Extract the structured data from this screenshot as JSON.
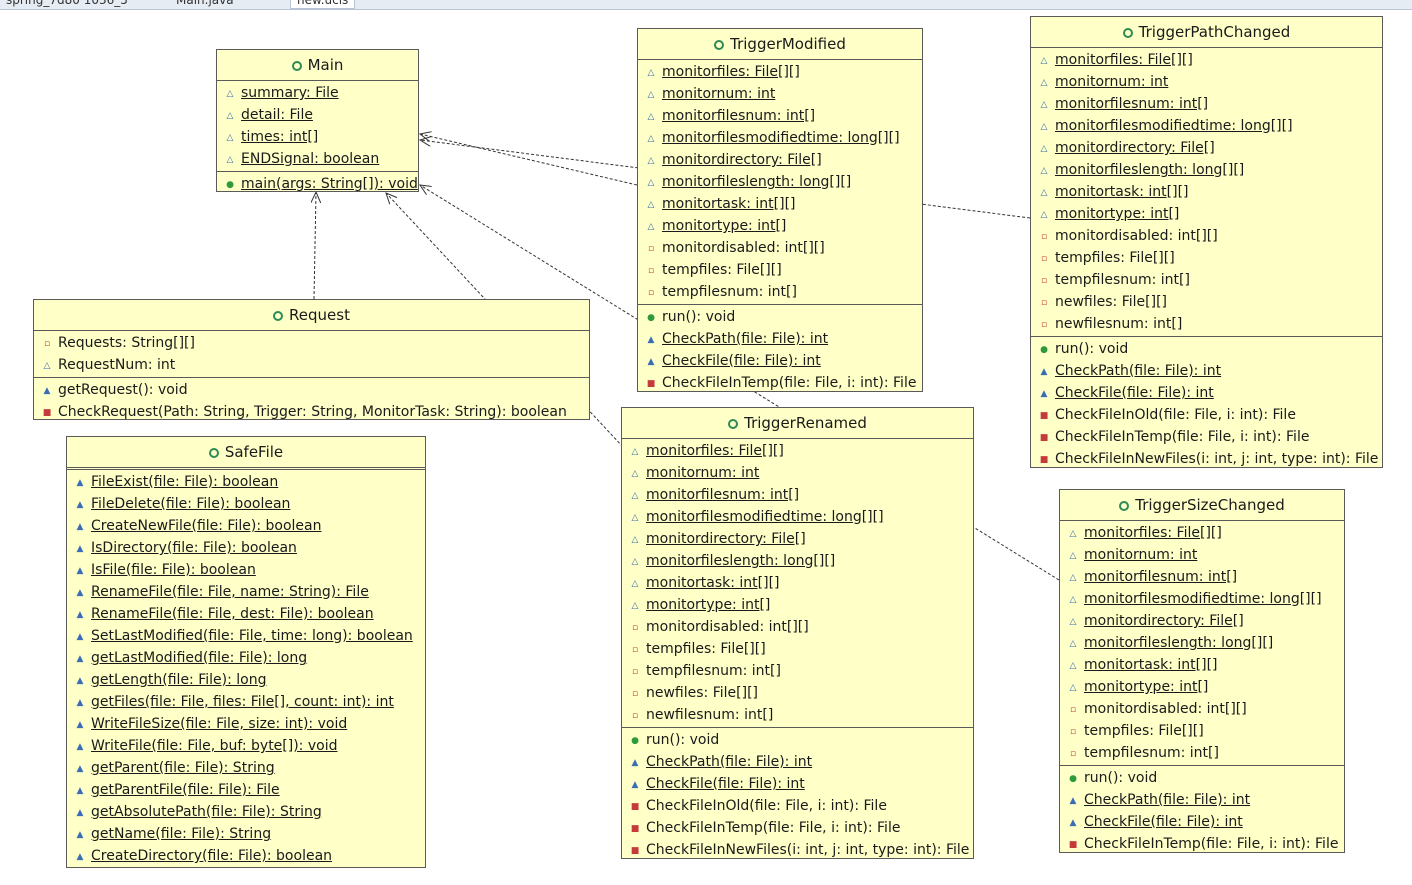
{
  "tabs": [
    {
      "label": "spring_7d80 1036_5"
    },
    {
      "label": "Main.java"
    },
    {
      "label": "new.ucls",
      "active": true
    }
  ],
  "classes": [
    {
      "id": "main",
      "name": "Main",
      "attributes": [
        {
          "text": "summary: File",
          "visibility": "package",
          "static": true
        },
        {
          "text": "detail: File",
          "visibility": "package",
          "static": true
        },
        {
          "text": "times: int[]",
          "visibility": "package",
          "static": true
        },
        {
          "text": "ENDSignal: boolean",
          "visibility": "package",
          "static": true
        }
      ],
      "methods": [
        {
          "text": "main(args: String[]): void",
          "visibility": "public",
          "static": true
        }
      ]
    },
    {
      "id": "request",
      "name": "Request",
      "attributes": [
        {
          "text": "Requests: String[][]",
          "visibility": "private",
          "static": false
        },
        {
          "text": "RequestNum: int",
          "visibility": "package",
          "static": false
        }
      ],
      "methods": [
        {
          "text": "getRequest(): void",
          "visibility": "package-method",
          "static": false
        },
        {
          "text": "CheckRequest(Path: String, Trigger: String, MonitorTask: String): boolean",
          "visibility": "private-method",
          "static": false
        }
      ]
    },
    {
      "id": "safefile",
      "name": "SafeFile",
      "attributes": [],
      "methods": [
        {
          "text": "FileExist(file: File): boolean",
          "visibility": "package-method",
          "static": true
        },
        {
          "text": "FileDelete(file: File): boolean",
          "visibility": "package-method",
          "static": true
        },
        {
          "text": "CreateNewFile(file: File): boolean",
          "visibility": "package-method",
          "static": true
        },
        {
          "text": "IsDirectory(file: File): boolean",
          "visibility": "package-method",
          "static": true
        },
        {
          "text": "IsFile(file: File): boolean",
          "visibility": "package-method",
          "static": true
        },
        {
          "text": "RenameFile(file: File, name: String): File",
          "visibility": "package-method",
          "static": true
        },
        {
          "text": "RenameFile(file: File, dest: File): boolean",
          "visibility": "package-method",
          "static": true
        },
        {
          "text": "SetLastModified(file: File, time: long): boolean",
          "visibility": "package-method",
          "static": true
        },
        {
          "text": "getLastModified(file: File): long",
          "visibility": "package-method",
          "static": true
        },
        {
          "text": "getLength(file: File): long",
          "visibility": "package-method",
          "static": true
        },
        {
          "text": "getFiles(file: File, files: File[], count: int): int",
          "visibility": "package-method",
          "static": true
        },
        {
          "text": "WriteFileSize(file: File, size: int): void",
          "visibility": "package-method",
          "static": true
        },
        {
          "text": "WriteFile(file: File, buf: byte[]): void",
          "visibility": "package-method",
          "static": true
        },
        {
          "text": "getParent(file: File): String",
          "visibility": "package-method",
          "static": true
        },
        {
          "text": "getParentFile(file: File): File",
          "visibility": "package-method",
          "static": true
        },
        {
          "text": "getAbsolutePath(file: File): String",
          "visibility": "package-method",
          "static": true
        },
        {
          "text": "getName(file: File): String",
          "visibility": "package-method",
          "static": true
        },
        {
          "text": "CreateDirectory(file: File): boolean",
          "visibility": "package-method",
          "static": true
        }
      ]
    },
    {
      "id": "modified",
      "name": "TriggerModified",
      "attributes": [
        {
          "text": "monitorfiles: File[][]",
          "visibility": "package",
          "static": true
        },
        {
          "text": "monitornum: int",
          "visibility": "package",
          "static": true
        },
        {
          "text": "monitorfilesnum: int[]",
          "visibility": "package",
          "static": true
        },
        {
          "text": "monitorfilesmodifiedtime: long[][]",
          "visibility": "package",
          "static": true
        },
        {
          "text": "monitordirectory: File[]",
          "visibility": "package",
          "static": true
        },
        {
          "text": "monitorfileslength: long[][]",
          "visibility": "package",
          "static": true
        },
        {
          "text": "monitortask: int[][]",
          "visibility": "package",
          "static": true
        },
        {
          "text": "monitortype: int[]",
          "visibility": "package",
          "static": true
        },
        {
          "text": "monitordisabled: int[][]",
          "visibility": "private",
          "static": false
        },
        {
          "text": "tempfiles: File[][]",
          "visibility": "private",
          "static": false
        },
        {
          "text": "tempfilesnum: int[]",
          "visibility": "private",
          "static": false
        }
      ],
      "methods": [
        {
          "text": "run(): void",
          "visibility": "public",
          "static": false
        },
        {
          "text": "CheckPath(file: File): int",
          "visibility": "package-method",
          "static": true
        },
        {
          "text": "CheckFile(file: File): int",
          "visibility": "package-method",
          "static": true
        },
        {
          "text": "CheckFileInTemp(file: File, i: int): File",
          "visibility": "private-method",
          "static": false
        }
      ]
    },
    {
      "id": "pathchanged",
      "name": "TriggerPathChanged",
      "attributes": [
        {
          "text": "monitorfiles: File[][]",
          "visibility": "package",
          "static": true
        },
        {
          "text": "monitornum: int",
          "visibility": "package",
          "static": true
        },
        {
          "text": "monitorfilesnum: int[]",
          "visibility": "package",
          "static": true
        },
        {
          "text": "monitorfilesmodifiedtime: long[][]",
          "visibility": "package",
          "static": true
        },
        {
          "text": "monitordirectory: File[]",
          "visibility": "package",
          "static": true
        },
        {
          "text": "monitorfileslength: long[][]",
          "visibility": "package",
          "static": true
        },
        {
          "text": "monitortask: int[][]",
          "visibility": "package",
          "static": true
        },
        {
          "text": "monitortype: int[]",
          "visibility": "package",
          "static": true
        },
        {
          "text": "monitordisabled: int[][]",
          "visibility": "private",
          "static": false
        },
        {
          "text": "tempfiles: File[][]",
          "visibility": "private",
          "static": false
        },
        {
          "text": "tempfilesnum: int[]",
          "visibility": "private",
          "static": false
        },
        {
          "text": "newfiles: File[][]",
          "visibility": "private",
          "static": false
        },
        {
          "text": "newfilesnum: int[]",
          "visibility": "private",
          "static": false
        }
      ],
      "methods": [
        {
          "text": "run(): void",
          "visibility": "public",
          "static": false
        },
        {
          "text": "CheckPath(file: File): int",
          "visibility": "package-method",
          "static": true
        },
        {
          "text": "CheckFile(file: File): int",
          "visibility": "package-method",
          "static": true
        },
        {
          "text": "CheckFileInOld(file: File, i: int): File",
          "visibility": "private-method",
          "static": false
        },
        {
          "text": "CheckFileInTemp(file: File, i: int): File",
          "visibility": "private-method",
          "static": false
        },
        {
          "text": "CheckFileInNewFiles(i: int, j: int, type: int): File",
          "visibility": "private-method",
          "static": false
        }
      ]
    },
    {
      "id": "renamed",
      "name": "TriggerRenamed",
      "attributes": [
        {
          "text": "monitorfiles: File[][]",
          "visibility": "package",
          "static": true
        },
        {
          "text": "monitornum: int",
          "visibility": "package",
          "static": true
        },
        {
          "text": "monitorfilesnum: int[]",
          "visibility": "package",
          "static": true
        },
        {
          "text": "monitorfilesmodifiedtime: long[][]",
          "visibility": "package",
          "static": true
        },
        {
          "text": "monitordirectory: File[]",
          "visibility": "package",
          "static": true
        },
        {
          "text": "monitorfileslength: long[][]",
          "visibility": "package",
          "static": true
        },
        {
          "text": "monitortask: int[][]",
          "visibility": "package",
          "static": true
        },
        {
          "text": "monitortype: int[]",
          "visibility": "package",
          "static": true
        },
        {
          "text": "monitordisabled: int[][]",
          "visibility": "private",
          "static": false
        },
        {
          "text": "tempfiles: File[][]",
          "visibility": "private",
          "static": false
        },
        {
          "text": "tempfilesnum: int[]",
          "visibility": "private",
          "static": false
        },
        {
          "text": "newfiles: File[][]",
          "visibility": "private",
          "static": false
        },
        {
          "text": "newfilesnum: int[]",
          "visibility": "private",
          "static": false
        }
      ],
      "methods": [
        {
          "text": "run(): void",
          "visibility": "public",
          "static": false
        },
        {
          "text": "CheckPath(file: File): int",
          "visibility": "package-method",
          "static": true
        },
        {
          "text": "CheckFile(file: File): int",
          "visibility": "package-method",
          "static": true
        },
        {
          "text": "CheckFileInOld(file: File, i: int): File",
          "visibility": "private-method",
          "static": false
        },
        {
          "text": "CheckFileInTemp(file: File, i: int): File",
          "visibility": "private-method",
          "static": false
        },
        {
          "text": "CheckFileInNewFiles(i: int, j: int, type: int): File",
          "visibility": "private-method",
          "static": false
        }
      ]
    },
    {
      "id": "sizechanged",
      "name": "TriggerSizeChanged",
      "attributes": [
        {
          "text": "monitorfiles: File[][]",
          "visibility": "package",
          "static": true
        },
        {
          "text": "monitornum: int",
          "visibility": "package",
          "static": true
        },
        {
          "text": "monitorfilesnum: int[]",
          "visibility": "package",
          "static": true
        },
        {
          "text": "monitorfilesmodifiedtime: long[][]",
          "visibility": "package",
          "static": true
        },
        {
          "text": "monitordirectory: File[]",
          "visibility": "package",
          "static": true
        },
        {
          "text": "monitorfileslength: long[][]",
          "visibility": "package",
          "static": true
        },
        {
          "text": "monitortask: int[][]",
          "visibility": "package",
          "static": true
        },
        {
          "text": "monitortype: int[]",
          "visibility": "package",
          "static": true
        },
        {
          "text": "monitordisabled: int[][]",
          "visibility": "private",
          "static": false
        },
        {
          "text": "tempfiles: File[][]",
          "visibility": "private",
          "static": false
        },
        {
          "text": "tempfilesnum: int[]",
          "visibility": "private",
          "static": false
        }
      ],
      "methods": [
        {
          "text": "run(): void",
          "visibility": "public",
          "static": false
        },
        {
          "text": "CheckPath(file: File): int",
          "visibility": "package-method",
          "static": true
        },
        {
          "text": "CheckFile(file: File): int",
          "visibility": "package-method",
          "static": true
        },
        {
          "text": "CheckFileInTemp(file: File, i: int): File",
          "visibility": "private-method",
          "static": false
        }
      ]
    }
  ],
  "dependencies": [
    {
      "from": "request",
      "to": "main"
    },
    {
      "from": "modified",
      "to": "main"
    },
    {
      "from": "pathchanged",
      "to": "main"
    },
    {
      "from": "renamed",
      "to": "main"
    },
    {
      "from": "sizechanged",
      "to": "main"
    }
  ]
}
